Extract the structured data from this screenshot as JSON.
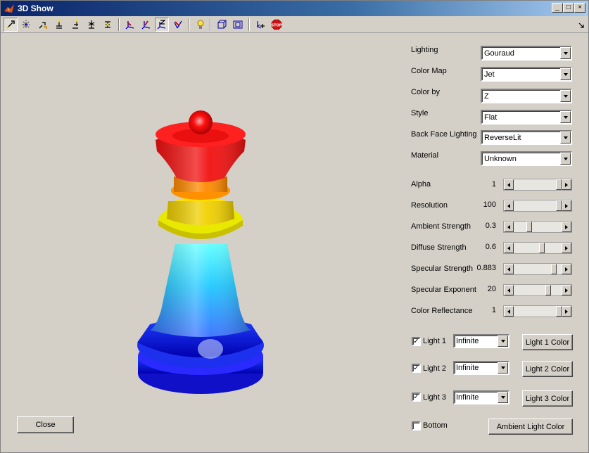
{
  "window": {
    "title": "3D Show"
  },
  "toolbar": {
    "tools": [
      {
        "icon": "select-arrow-icon"
      },
      {
        "icon": "select-points-icon"
      },
      {
        "icon": "rotate-icon"
      },
      {
        "icon": "move-x-icon"
      },
      {
        "icon": "move-y-icon"
      },
      {
        "icon": "move-z-icon"
      },
      {
        "icon": "move-free-icon"
      },
      {
        "icon": "axis-x-icon"
      },
      {
        "icon": "axis-y-icon"
      },
      {
        "icon": "axis-z-icon"
      },
      {
        "icon": "axis-free-icon"
      },
      {
        "icon": "light-bulb-icon"
      },
      {
        "icon": "perspective-icon"
      },
      {
        "icon": "orthographic-icon"
      },
      {
        "icon": "add-point-icon"
      },
      {
        "icon": "stop-icon"
      }
    ],
    "stop_label": "STOP"
  },
  "controls": {
    "lighting": {
      "label": "Lighting",
      "value": "Gouraud"
    },
    "color_map": {
      "label": "Color Map",
      "value": "Jet"
    },
    "color_by": {
      "label": "Color by",
      "value": "Z"
    },
    "style": {
      "label": "Style",
      "value": "Flat"
    },
    "back_face": {
      "label": "Back Face Lighting",
      "value": "ReverseLit"
    },
    "material": {
      "label": "Material",
      "value": "Unknown"
    }
  },
  "sliders": {
    "alpha": {
      "label": "Alpha",
      "value": "1",
      "fraction": 1.0
    },
    "resolution": {
      "label": "Resolution",
      "value": "100",
      "fraction": 1.0
    },
    "ambient": {
      "label": "Ambient Strength",
      "value": "0.3",
      "fraction": 0.3
    },
    "diffuse": {
      "label": "Diffuse Strength",
      "value": "0.6",
      "fraction": 0.6
    },
    "specular": {
      "label": "Specular Strength",
      "value": "0.883",
      "fraction": 0.883
    },
    "exponent": {
      "label": "Specular Exponent",
      "value": "20",
      "fraction": 0.75
    },
    "reflectance": {
      "label": "Color Reflectance",
      "value": "1",
      "fraction": 1.0
    }
  },
  "lights": [
    {
      "label": "Light 1",
      "checked": true,
      "type": "Infinite",
      "color_button": "Light 1 Color"
    },
    {
      "label": "Light 2",
      "checked": true,
      "type": "Infinite",
      "color_button": "Light 2 Color"
    },
    {
      "label": "Light 3",
      "checked": true,
      "type": "Infinite",
      "color_button": "Light 3 Color"
    }
  ],
  "bottom": {
    "label": "Bottom",
    "checked": false
  },
  "buttons": {
    "ambient_color": "Ambient Light Color",
    "close": "Close"
  },
  "colors": {
    "titlebar": "#0a246a",
    "face": "#d4d0c8"
  }
}
